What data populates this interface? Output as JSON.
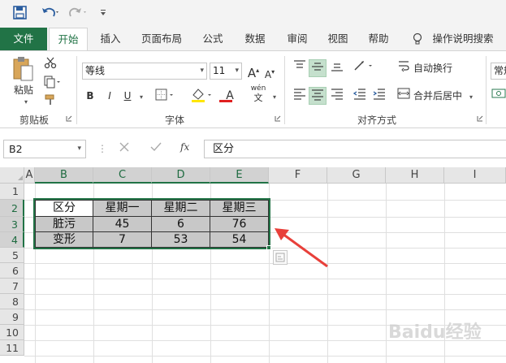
{
  "qat": {
    "save_icon": "save-icon",
    "undo_icon": "undo-icon",
    "redo_icon": "redo-icon",
    "customize_icon": "customize-qat-icon"
  },
  "tabs": [
    {
      "label": "文件"
    },
    {
      "label": "开始"
    },
    {
      "label": "插入"
    },
    {
      "label": "页面布局"
    },
    {
      "label": "公式"
    },
    {
      "label": "数据"
    },
    {
      "label": "审阅"
    },
    {
      "label": "视图"
    },
    {
      "label": "帮助"
    },
    {
      "label": "操作说明搜索"
    }
  ],
  "ribbon": {
    "clipboard": {
      "paste_label": "粘贴",
      "group_label": "剪贴板"
    },
    "font": {
      "font_name": "等线",
      "font_size": "11",
      "bold": "B",
      "italic": "I",
      "underline": "U",
      "wen": "wén",
      "font_color_letter": "A",
      "group_label": "字体"
    },
    "alignment": {
      "wrap_text": "自动换行",
      "merge_center": "合并后居中",
      "group_label": "对齐方式"
    },
    "number": {
      "format_label": "常规"
    }
  },
  "formula_bar": {
    "name_box": "B2",
    "fx": "fx",
    "formula": "区分"
  },
  "grid": {
    "columns": [
      "A",
      "B",
      "C",
      "D",
      "E",
      "F",
      "G",
      "H",
      "I"
    ],
    "rows": [
      "1",
      "2",
      "3",
      "4",
      "5",
      "6",
      "7",
      "8",
      "9",
      "10",
      "11"
    ],
    "table": {
      "header": [
        "区分",
        "星期一",
        "星期二",
        "星期三"
      ],
      "rows": [
        [
          "脏污",
          "45",
          "6",
          "76"
        ],
        [
          "变形",
          "7",
          "53",
          "54"
        ]
      ]
    }
  },
  "watermark": {
    "text": "Baidu经验"
  }
}
